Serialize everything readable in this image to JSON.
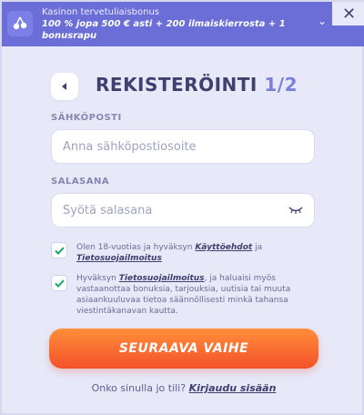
{
  "banner": {
    "title": "Kasinon tervetuliaisbonus",
    "offer": "100 % jopa 500 € asti + 200 ilmaiskierrosta + 1 bonusrapu",
    "icon": "cherry-icon",
    "chevron": "⌄",
    "close": "✕"
  },
  "header": {
    "back_icon": "back-arrow-icon",
    "title": "REKISTERÖINTI",
    "step": "1/2"
  },
  "email": {
    "label": "SÄHKÖPOSTI",
    "placeholder": "Anna sähköpostiosoite"
  },
  "password": {
    "label": "SALASANA",
    "placeholder": "Syötä salasana",
    "visibility_icon": "eye-closed-icon"
  },
  "consents": [
    {
      "prefix": "Olen 18-vuotias ja hyväksyn ",
      "link1": "Käyttöehdot",
      "mid": " ja ",
      "link2": "Tietosuojailmoitus",
      "checked": true
    },
    {
      "prefix": "Hyväksyn ",
      "link": "Tietosuojailmoitus",
      "suffix": ", ja haluaisi myös vastaanottaa bonuksia, tarjouksia, uutisia tai muuta asiaankuuluvaa tietoa säännöllisesti minkä tahansa viestintäkanavan kautta.",
      "checked": true
    }
  ],
  "cta": {
    "label": "SEURAAVA VAIHE"
  },
  "login": {
    "prompt": "Onko sinulla jo tili?",
    "link": "Kirjaudu sisään"
  },
  "colors": {
    "banner": "#6b6ed6",
    "accent_orange": "#f4512a",
    "text_dark": "#3f4070",
    "check_green": "#1aa868"
  }
}
